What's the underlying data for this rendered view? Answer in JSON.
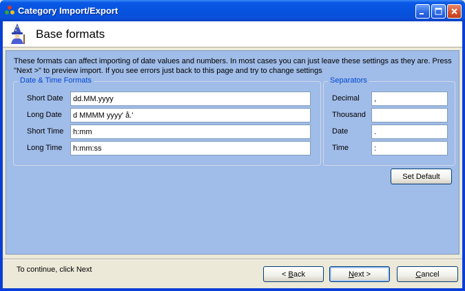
{
  "window": {
    "title": "Category Import/Export",
    "icons": {
      "app": "category-app-icon",
      "minimize": "minimize-icon",
      "maximize": "maximize-icon",
      "close": "close-icon"
    }
  },
  "header": {
    "title": "Base formats",
    "icon": "wizard-icon"
  },
  "description": "These formats can affect importing of date values and numbers. In most cases you can just leave these settings as they are. Press \"Next >\" to preview import. If you see errors just back to this page and try to change settings",
  "datetime": {
    "legend": "Date & Time Formats",
    "fields": [
      {
        "label": "Short Date",
        "value": "dd.MM.yyyy"
      },
      {
        "label": "Long Date",
        "value": "d MMMM yyyy' å.'"
      },
      {
        "label": "Short Time",
        "value": "h:mm"
      },
      {
        "label": "Long Time",
        "value": "h:mm:ss"
      }
    ]
  },
  "separators": {
    "legend": "Separators",
    "fields": [
      {
        "label": "Decimal",
        "value": ","
      },
      {
        "label": "Thousand",
        "value": ""
      },
      {
        "label": "Date",
        "value": "."
      },
      {
        "label": "Time",
        "value": ":"
      }
    ]
  },
  "set_default_label": "Set Default",
  "continue_text": "To continue, click Next",
  "buttons": {
    "back": {
      "prefix": "< ",
      "accel": "B",
      "rest": "ack"
    },
    "next": {
      "accel": "N",
      "rest": "ext >"
    },
    "cancel": {
      "accel": "C",
      "rest": "ancel"
    }
  },
  "colors": {
    "title_bar": "#0553de",
    "panel": "#a0bce8",
    "legend_text": "#0046d5",
    "close_button": "#d3502a"
  }
}
